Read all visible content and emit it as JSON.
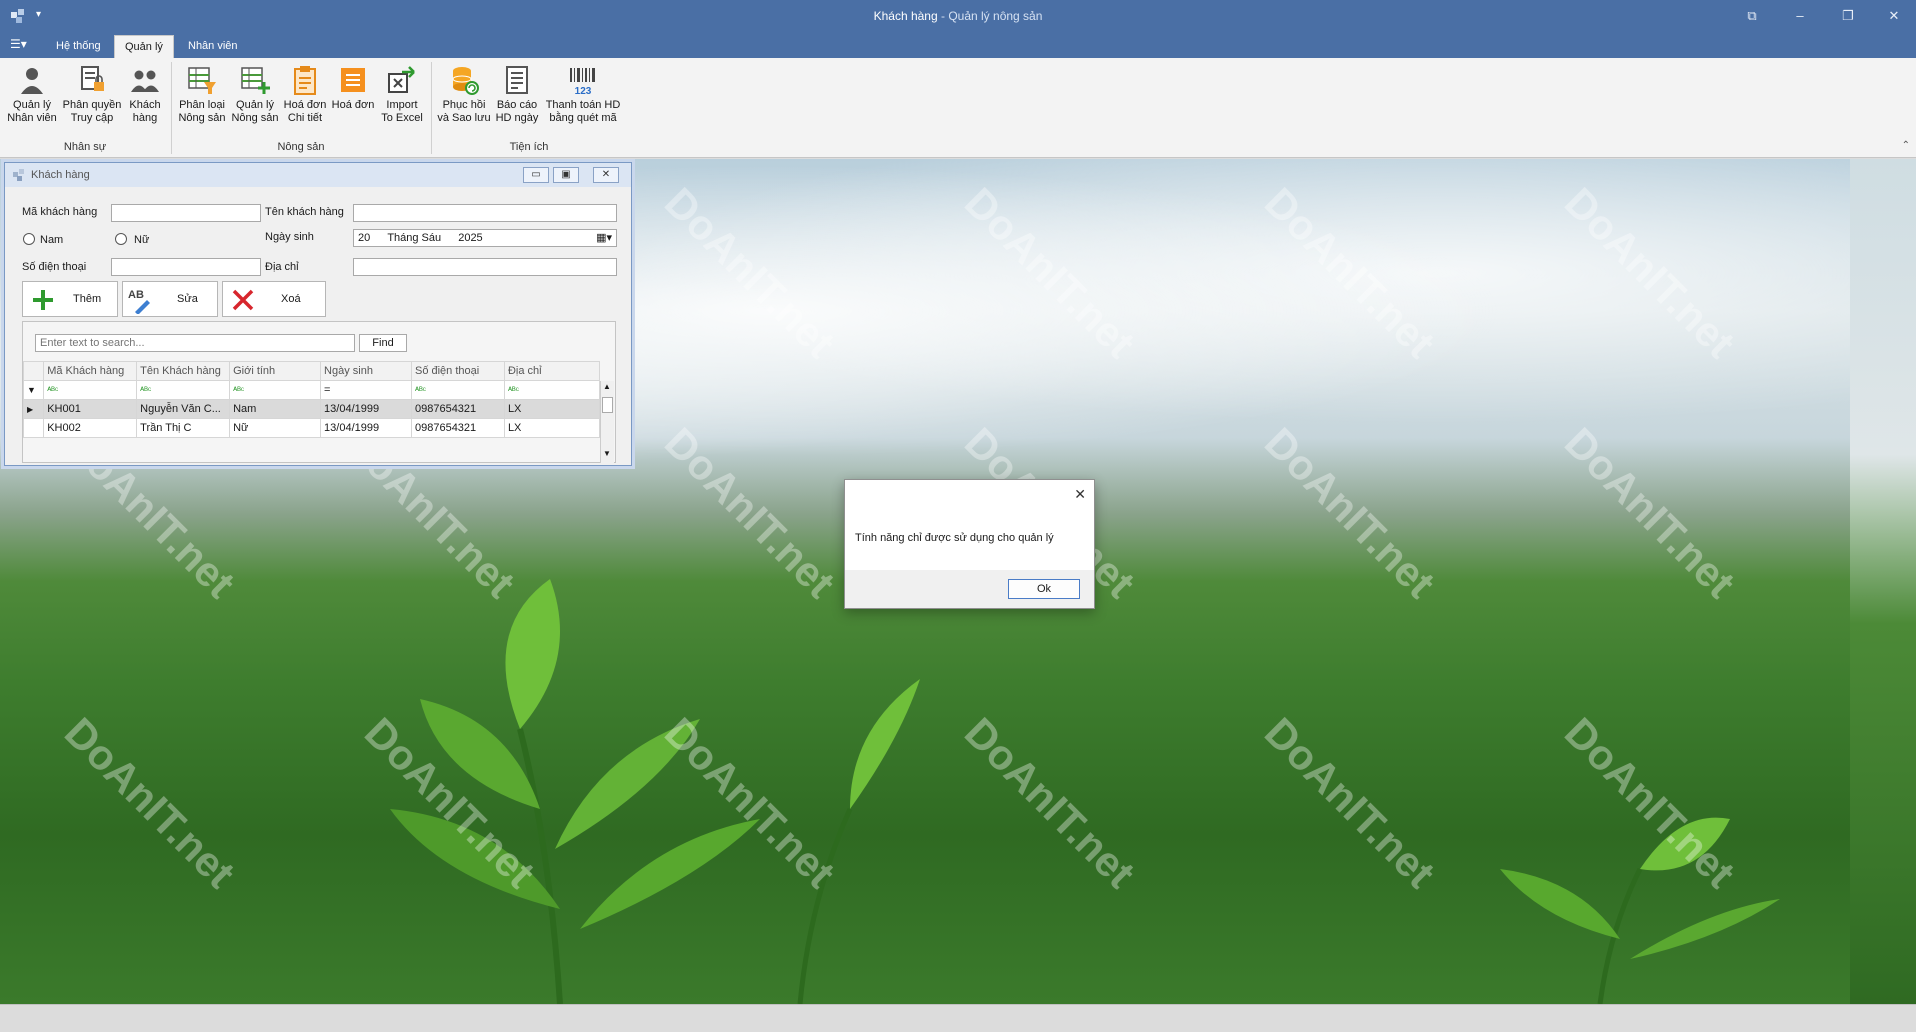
{
  "window": {
    "title": "Khách hàng",
    "title_sep": " - ",
    "subtitle": "Quản lý nông sản",
    "controls": [
      "restore-icon",
      "minimize-icon",
      "maximize-icon",
      "close-icon"
    ]
  },
  "ribbon": {
    "tabs": [
      {
        "label": "Hệ thống"
      },
      {
        "label": "Quản lý"
      },
      {
        "label": "Nhân viên"
      }
    ],
    "groups": [
      {
        "label": "Nhân sự"
      },
      {
        "label": "Nông sản"
      },
      {
        "label": "Tiện ích"
      }
    ],
    "buttons": [
      {
        "line1": "Quản lý",
        "line2": "Nhân viên",
        "icon": "employee-icon"
      },
      {
        "line1": "Phân quyền",
        "line2": "Truy cập",
        "icon": "permission-icon"
      },
      {
        "line1": "Khách",
        "line2": "hàng",
        "icon": "customers-icon"
      },
      {
        "line1": "Phân loại",
        "line2": "Nông sản",
        "icon": "category-icon"
      },
      {
        "line1": "Quản lý",
        "line2": "Nông sản",
        "icon": "product-icon"
      },
      {
        "line1": "Hoá đơn",
        "line2": "Chi tiết",
        "icon": "invoice-detail-icon"
      },
      {
        "line1": "Hoá đơn",
        "line2": "",
        "icon": "invoice-icon"
      },
      {
        "line1": "Import",
        "line2": "To Excel",
        "icon": "import-excel-icon"
      },
      {
        "line1": "Phục hồi",
        "line2": "và Sao lưu",
        "icon": "database-backup-icon"
      },
      {
        "line1": "Báo cáo",
        "line2": "HD ngày",
        "icon": "report-icon"
      },
      {
        "line1": "Thanh toán HD",
        "line2": "bằng quét mã",
        "icon": "barcode-icon"
      }
    ]
  },
  "customer_form": {
    "window_title": "Khách hàng",
    "labels": {
      "ma_khach_hang": "Mã khách hàng",
      "ten_khach_hang": "Tên khách hàng",
      "ngay_sinh": "Ngày sinh",
      "so_dien_thoai": "Số điện thoại",
      "dia_chi": "Địa chỉ",
      "nam": "Nam",
      "nu": "Nữ"
    },
    "values": {
      "ma_khach_hang": "",
      "ten_khach_hang": "",
      "so_dien_thoai": "",
      "dia_chi": "",
      "ngay_sinh_day": "20",
      "ngay_sinh_month": "Tháng Sáu",
      "ngay_sinh_year": "2025"
    },
    "buttons": {
      "them": "Thêm",
      "sua": "Sửa",
      "xoa": "Xoá",
      "find": "Find"
    },
    "search_placeholder": "Enter text to search...",
    "grid": {
      "columns": [
        "Mã Khách hàng",
        "Tên Khách hàng",
        "Giới tính",
        "Ngày sinh",
        "Số điện thoại",
        "Địa chỉ"
      ],
      "filter_equal": "=",
      "rows": [
        [
          "KH001",
          "Nguyễn Văn C...",
          "Nam",
          "13/04/1999",
          "0987654321",
          "LX"
        ],
        [
          "KH002",
          "Trần Thị C",
          "Nữ",
          "13/04/1999",
          "0987654321",
          "LX"
        ]
      ]
    }
  },
  "dialog": {
    "message": "Tính năng chỉ được sử dụng cho quản lý",
    "ok_label": "Ok"
  },
  "watermark": {
    "brand": "DoAnIT.net"
  },
  "colors": {
    "titlebar": "#4a6fa5",
    "ribbon": "#f3f3f3",
    "accent": "#4a7cc7"
  }
}
